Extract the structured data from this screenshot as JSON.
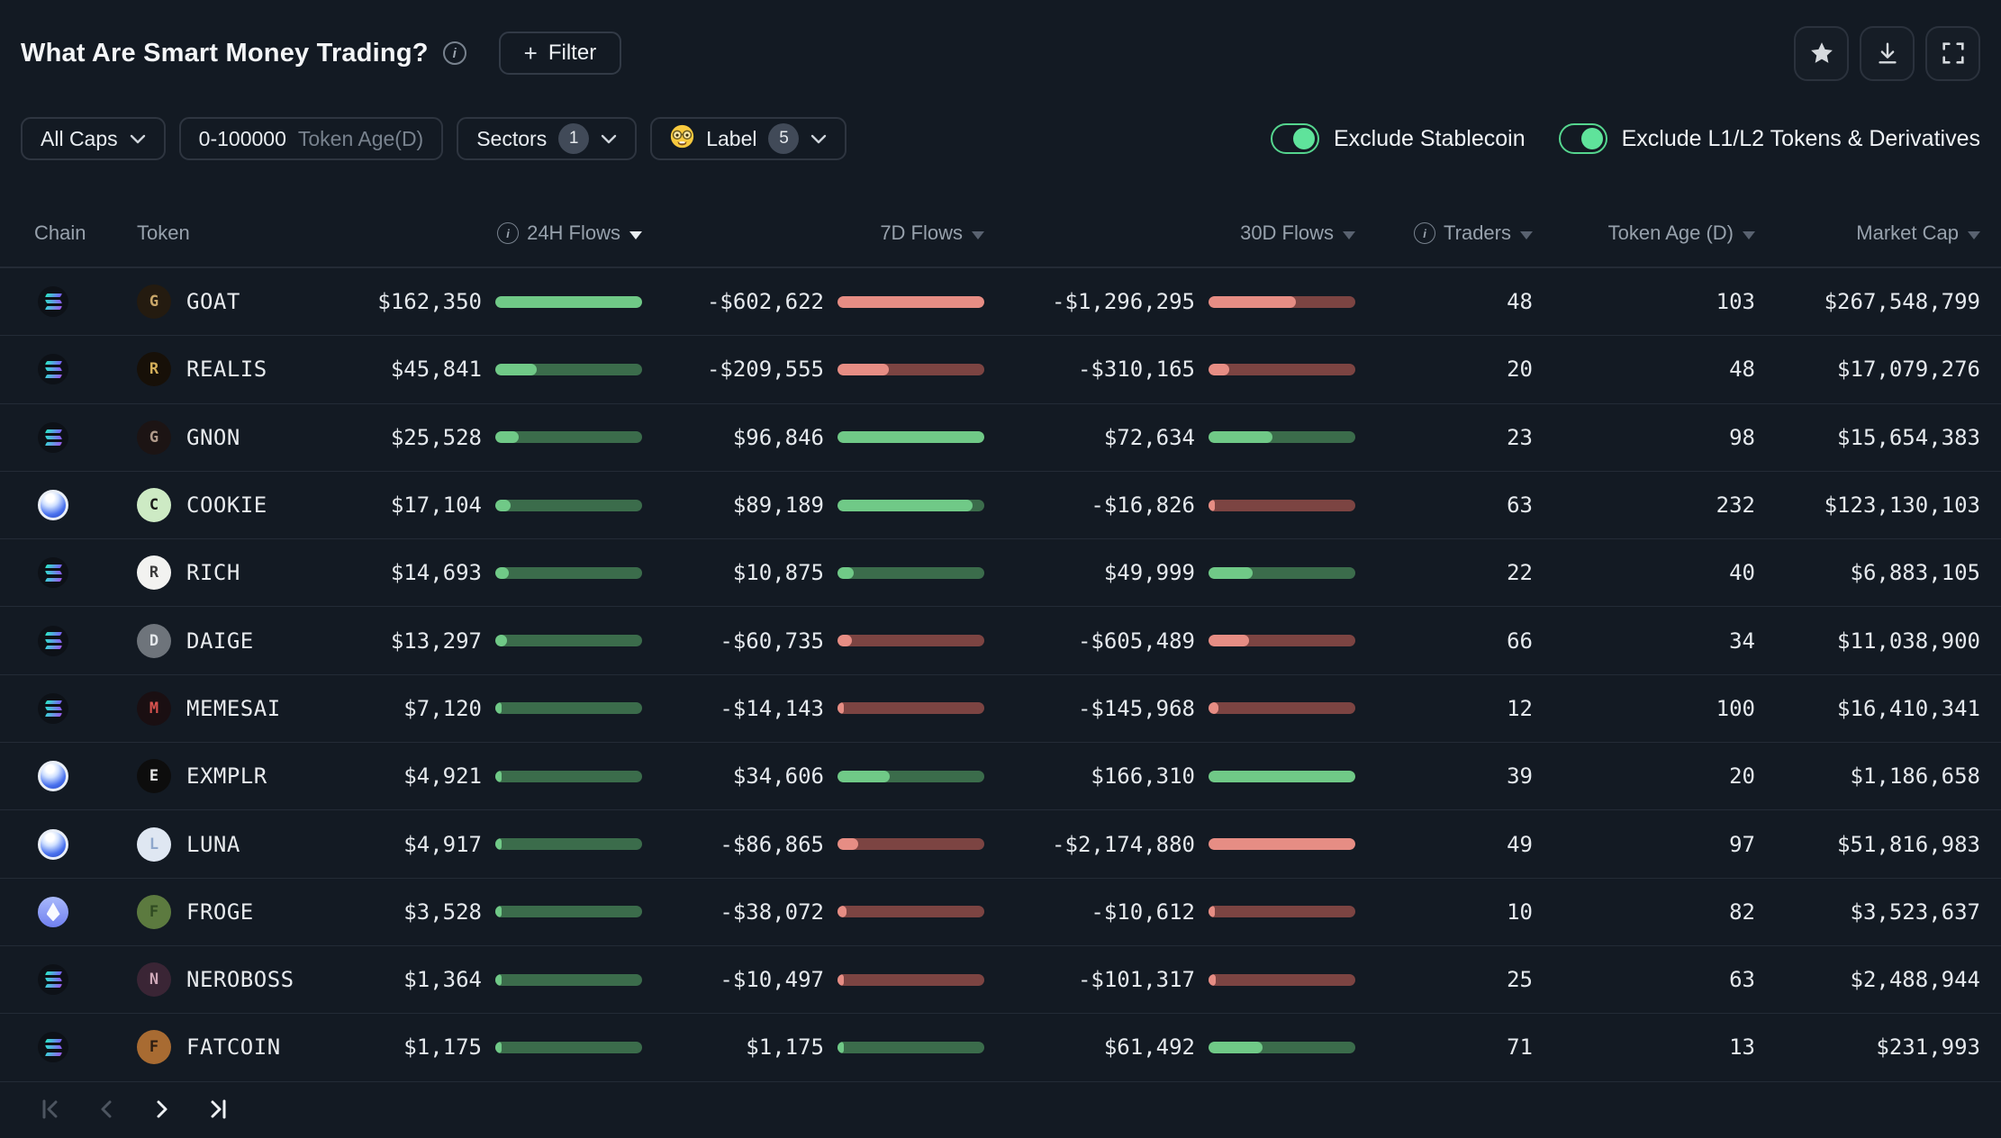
{
  "title_bar": {
    "title": "What Are Smart Money Trading?",
    "filter_button_label": "Filter",
    "filter_button_plus": "+"
  },
  "filter_bar": {
    "cap_filter_label": "All Caps",
    "token_age_value": "0-100000",
    "token_age_suffix": "Token Age(D)",
    "sectors_label": "Sectors",
    "sectors_count": "1",
    "label_label": "Label",
    "label_count": "5",
    "label_emoji": "nerd-face",
    "toggle_stablecoin_label": "Exclude Stablecoin",
    "toggle_stablecoin_on": true,
    "toggle_l1l2_label": "Exclude L1/L2 Tokens & Derivatives",
    "toggle_l1l2_on": true
  },
  "table": {
    "headers": {
      "chain": "Chain",
      "token": "Token",
      "flow24": "24H Flows",
      "flow7": "7D Flows",
      "flow30": "30D Flows",
      "traders": "Traders",
      "age": "Token Age (D)",
      "mcap": "Market Cap"
    },
    "sort": {
      "column": "24H Flows",
      "direction": "desc"
    },
    "rows": [
      {
        "chain": "solana",
        "token": "GOAT",
        "flow24": 162350,
        "flow24_display": "$162,350",
        "flow7": -602622,
        "flow7_display": "-$602,622",
        "flow30": -1296295,
        "flow30_display": "-$1,296,295",
        "traders": "48",
        "age": "103",
        "mcap": "$267,548,799",
        "avatar_bg": "#241b10",
        "avatar_fg": "#c9a76a"
      },
      {
        "chain": "solana",
        "token": "REALIS",
        "flow24": 45841,
        "flow24_display": "$45,841",
        "flow7": -209555,
        "flow7_display": "-$209,555",
        "flow30": -310165,
        "flow30_display": "-$310,165",
        "traders": "20",
        "age": "48",
        "mcap": "$17,079,276",
        "avatar_bg": "#171008",
        "avatar_fg": "#d4af5a"
      },
      {
        "chain": "solana",
        "token": "GNON",
        "flow24": 25528,
        "flow24_display": "$25,528",
        "flow7": 96846,
        "flow7_display": "$96,846",
        "flow30": 72634,
        "flow30_display": "$72,634",
        "traders": "23",
        "age": "98",
        "mcap": "$15,654,383",
        "avatar_bg": "#1c1414",
        "avatar_fg": "#b09a8a"
      },
      {
        "chain": "sphere",
        "token": "COOKIE",
        "flow24": 17104,
        "flow24_display": "$17,104",
        "flow7": 89189,
        "flow7_display": "$89,189",
        "flow30": -16826,
        "flow30_display": "-$16,826",
        "traders": "63",
        "age": "232",
        "mcap": "$123,130,103",
        "avatar_bg": "#cdeac4",
        "avatar_fg": "#1a1a1a"
      },
      {
        "chain": "solana",
        "token": "RICH",
        "flow24": 14693,
        "flow24_display": "$14,693",
        "flow7": 10875,
        "flow7_display": "$10,875",
        "flow30": 49999,
        "flow30_display": "$49,999",
        "traders": "22",
        "age": "40",
        "mcap": "$6,883,105",
        "avatar_bg": "#f2f2f0",
        "avatar_fg": "#3a3a3a"
      },
      {
        "chain": "solana",
        "token": "DAIGE",
        "flow24": 13297,
        "flow24_display": "$13,297",
        "flow7": -60735,
        "flow7_display": "-$60,735",
        "flow30": -605489,
        "flow30_display": "-$605,489",
        "traders": "66",
        "age": "34",
        "mcap": "$11,038,900",
        "avatar_bg": "#6e747b",
        "avatar_fg": "#e4e7ea"
      },
      {
        "chain": "solana",
        "token": "MEMESAI",
        "flow24": 7120,
        "flow24_display": "$7,120",
        "flow7": -14143,
        "flow7_display": "-$14,143",
        "flow30": -145968,
        "flow30_display": "-$145,968",
        "traders": "12",
        "age": "100",
        "mcap": "$16,410,341",
        "avatar_bg": "#1a0f12",
        "avatar_fg": "#d9534f"
      },
      {
        "chain": "sphere",
        "token": "EXMPLR",
        "flow24": 4921,
        "flow24_display": "$4,921",
        "flow7": 34606,
        "flow7_display": "$34,606",
        "flow30": 166310,
        "flow30_display": "$166,310",
        "traders": "39",
        "age": "20",
        "mcap": "$1,186,658",
        "avatar_bg": "#0d0d0d",
        "avatar_fg": "#e8e8e8"
      },
      {
        "chain": "sphere",
        "token": "LUNA",
        "flow24": 4917,
        "flow24_display": "$4,917",
        "flow7": -86865,
        "flow7_display": "-$86,865",
        "flow30": -2174880,
        "flow30_display": "-$2,174,880",
        "traders": "49",
        "age": "97",
        "mcap": "$51,816,983",
        "avatar_bg": "#dfe7f2",
        "avatar_fg": "#8fa8cc"
      },
      {
        "chain": "ethereum",
        "token": "FROGE",
        "flow24": 3528,
        "flow24_display": "$3,528",
        "flow7": -38072,
        "flow7_display": "-$38,072",
        "flow30": -10612,
        "flow30_display": "-$10,612",
        "traders": "10",
        "age": "82",
        "mcap": "$3,523,637",
        "avatar_bg": "#5c7a3f",
        "avatar_fg": "#2f4a22"
      },
      {
        "chain": "solana",
        "token": "NEROBOSS",
        "flow24": 1364,
        "flow24_display": "$1,364",
        "flow7": -10497,
        "flow7_display": "-$10,497",
        "flow30": -101317,
        "flow30_display": "-$101,317",
        "traders": "25",
        "age": "63",
        "mcap": "$2,488,944",
        "avatar_bg": "#3a2535",
        "avatar_fg": "#cfa8b8"
      },
      {
        "chain": "solana",
        "token": "FATCOIN",
        "flow24": 1175,
        "flow24_display": "$1,175",
        "flow7": 1175,
        "flow7_display": "$1,175",
        "flow30": 61492,
        "flow30_display": "$61,492",
        "traders": "71",
        "age": "13",
        "mcap": "$231,993",
        "avatar_bg": "#a86b32",
        "avatar_fg": "#2b1c12"
      }
    ]
  },
  "pagination": {
    "buttons": [
      {
        "name": "first",
        "enabled": false
      },
      {
        "name": "prev",
        "enabled": false
      },
      {
        "name": "next",
        "enabled": true
      },
      {
        "name": "last",
        "enabled": true
      }
    ]
  },
  "colors": {
    "background": "#131a23",
    "positive_fill": "#70c987",
    "positive_track": "#3b6c4b",
    "negative_fill": "#e68d84",
    "negative_track": "#7c4442",
    "toggle_green": "#5fe39b"
  }
}
